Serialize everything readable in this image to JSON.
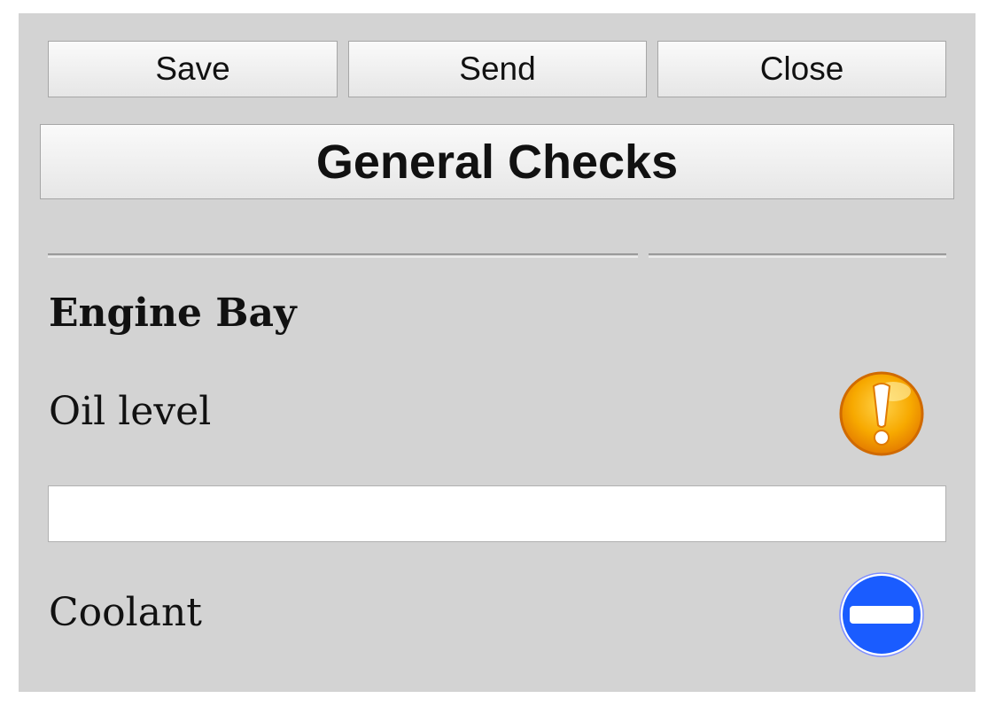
{
  "toolbar": {
    "save_label": "Save",
    "send_label": "Send",
    "close_label": "Close"
  },
  "page": {
    "title": "General Checks"
  },
  "section": {
    "heading": "Engine Bay",
    "items": [
      {
        "label": "Oil level",
        "status_icon": "warning-icon",
        "status_color": "#f29a00",
        "note_value": ""
      },
      {
        "label": "Coolant",
        "status_icon": "no-entry-icon",
        "status_color": "#1a5cff"
      }
    ]
  }
}
